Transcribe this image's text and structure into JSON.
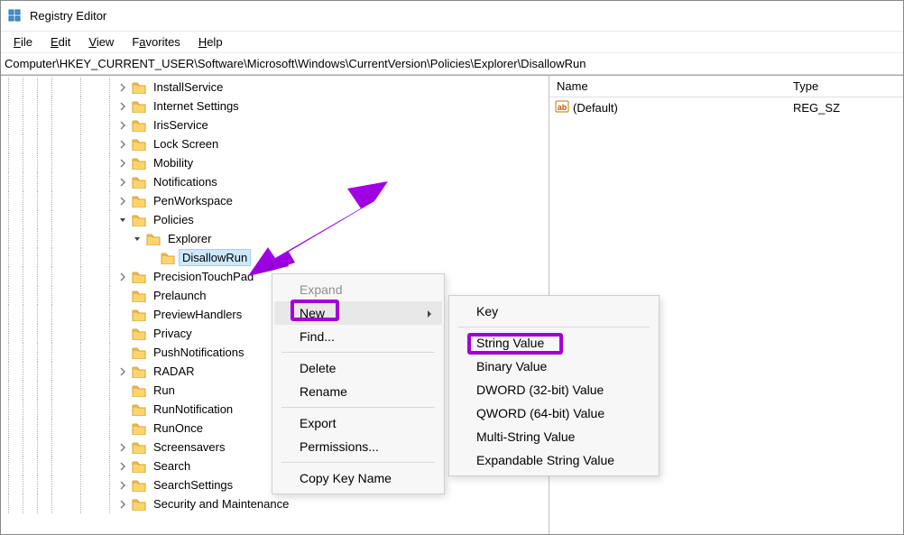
{
  "app": {
    "title": "Registry Editor"
  },
  "menubar": {
    "file": "File",
    "edit": "Edit",
    "view": "View",
    "favorites": "Favorites",
    "help": "Help"
  },
  "addressbar": {
    "path": "Computer\\HKEY_CURRENT_USER\\Software\\Microsoft\\Windows\\CurrentVersion\\Policies\\Explorer\\DisallowRun"
  },
  "tree": [
    {
      "label": "InstallService",
      "indent": 9,
      "chev": "right"
    },
    {
      "label": "Internet Settings",
      "indent": 9,
      "chev": "right"
    },
    {
      "label": "IrisService",
      "indent": 9,
      "chev": "right"
    },
    {
      "label": "Lock Screen",
      "indent": 9,
      "chev": "right"
    },
    {
      "label": "Mobility",
      "indent": 9,
      "chev": "right"
    },
    {
      "label": "Notifications",
      "indent": 9,
      "chev": "right"
    },
    {
      "label": "PenWorkspace",
      "indent": 9,
      "chev": "right"
    },
    {
      "label": "Policies",
      "indent": 9,
      "chev": "down"
    },
    {
      "label": "Explorer",
      "indent": 10,
      "chev": "down"
    },
    {
      "label": "DisallowRun",
      "indent": 11,
      "chev": "none",
      "selected": true
    },
    {
      "label": "PrecisionTouchPad",
      "indent": 9,
      "chev": "right"
    },
    {
      "label": "Prelaunch",
      "indent": 9,
      "chev": "none"
    },
    {
      "label": "PreviewHandlers",
      "indent": 9,
      "chev": "none"
    },
    {
      "label": "Privacy",
      "indent": 9,
      "chev": "none"
    },
    {
      "label": "PushNotifications",
      "indent": 9,
      "chev": "none"
    },
    {
      "label": "RADAR",
      "indent": 9,
      "chev": "right"
    },
    {
      "label": "Run",
      "indent": 9,
      "chev": "none"
    },
    {
      "label": "RunNotification",
      "indent": 9,
      "chev": "none"
    },
    {
      "label": "RunOnce",
      "indent": 9,
      "chev": "none"
    },
    {
      "label": "Screensavers",
      "indent": 9,
      "chev": "right"
    },
    {
      "label": "Search",
      "indent": 9,
      "chev": "right"
    },
    {
      "label": "SearchSettings",
      "indent": 9,
      "chev": "right"
    },
    {
      "label": "Security and Maintenance",
      "indent": 9,
      "chev": "right"
    }
  ],
  "list": {
    "col_name": "Name",
    "col_type": "Type",
    "rows": [
      {
        "name": "(Default)",
        "type": "REG_SZ"
      }
    ]
  },
  "ctx1": {
    "expand": "Expand",
    "new": "New",
    "find": "Find...",
    "delete": "Delete",
    "rename": "Rename",
    "export": "Export",
    "permissions": "Permissions...",
    "copykey": "Copy Key Name"
  },
  "ctx2": {
    "key": "Key",
    "string": "String Value",
    "binary": "Binary Value",
    "dword": "DWORD (32-bit) Value",
    "qword": "QWORD (64-bit) Value",
    "multi": "Multi-String Value",
    "expand": "Expandable String Value"
  }
}
